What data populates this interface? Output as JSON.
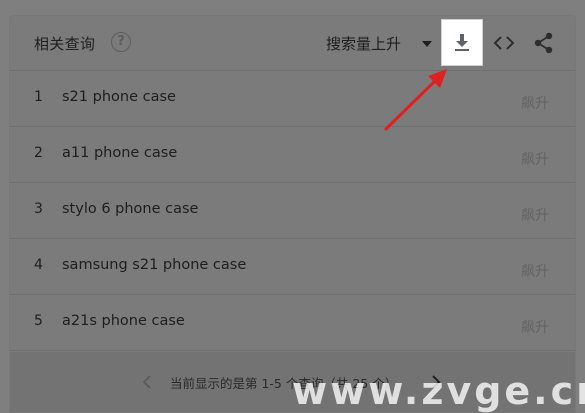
{
  "header": {
    "title": "相关查询",
    "help_icon": "help-circle-icon",
    "sort_label": "搜索量上升",
    "download_icon": "download-icon",
    "embed_icon": "code-embed-icon",
    "share_icon": "share-icon"
  },
  "queries": [
    {
      "rank": "1",
      "text": "s21 phone case",
      "trend": "飙升"
    },
    {
      "rank": "2",
      "text": "a11 phone case",
      "trend": "飙升"
    },
    {
      "rank": "3",
      "text": "stylo 6 phone case",
      "trend": "飙升"
    },
    {
      "rank": "4",
      "text": "samsung s21 phone case",
      "trend": "飙升"
    },
    {
      "rank": "5",
      "text": "a21s phone case",
      "trend": "飙升"
    }
  ],
  "footer": {
    "page_info": "当前显示的是第 1-5 个查询（共 25 个）",
    "prev_icon": "chevron-left-icon",
    "next_icon": "chevron-right-icon"
  },
  "watermark": "www.zvge.cn",
  "colors": {
    "overlay": "#7f7f7f",
    "annotation_arrow": "#e02020",
    "download_highlight": "#ffffff"
  }
}
